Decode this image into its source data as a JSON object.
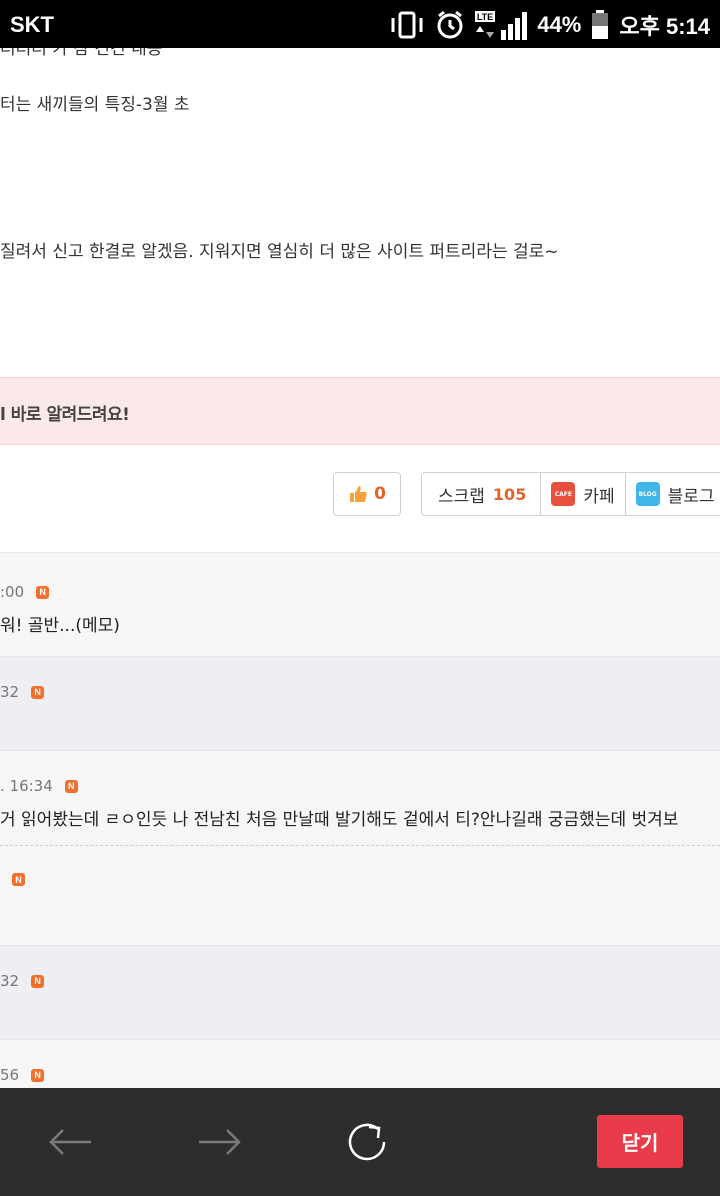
{
  "status_bar": {
    "carrier": "SKT",
    "battery_percent": "44%",
    "time": "오후 5:14",
    "network": "LTE"
  },
  "post": {
    "cut_line": "터터터 가 참 건건 내용",
    "line_1": "터는 새끼들의 특징-3월 초",
    "line_2": "질려서 신고 한결로 알겠음. 지워지면 열심히 더 많은 사이트 퍼트리라는 걸로~"
  },
  "notice": {
    "text": "l 바로 알려드려요!"
  },
  "actions": {
    "like_count": "0",
    "scrap_label": "스크랩",
    "scrap_count": "105",
    "cafe_label": "카페",
    "blog_label": "블로그",
    "cafe_icon_text": "CAFE",
    "blog_icon_text": "BLOG"
  },
  "comments": [
    {
      "meta": ":00",
      "text": "워! 골반...(메모)"
    },
    {
      "meta": "32",
      "text": ""
    },
    {
      "meta": ". 16:34",
      "text": "거 읽어봤는데 ㄹㅇ인듯 나 전남친 처음 만날때 발기해도 겉에서 티?안나길래 궁금했는데 벗겨보"
    },
    {
      "meta": "",
      "text": ""
    },
    {
      "meta": "32",
      "text": ""
    },
    {
      "meta": "56",
      "text": ""
    }
  ],
  "n_badge": "N",
  "bottom_bar": {
    "close_label": "닫기"
  },
  "colors": {
    "accent": "#e4622c",
    "close_button": "#ea3b4a",
    "notice_bg": "#fbe8e8",
    "bottom_bar": "#2d2d2d"
  }
}
